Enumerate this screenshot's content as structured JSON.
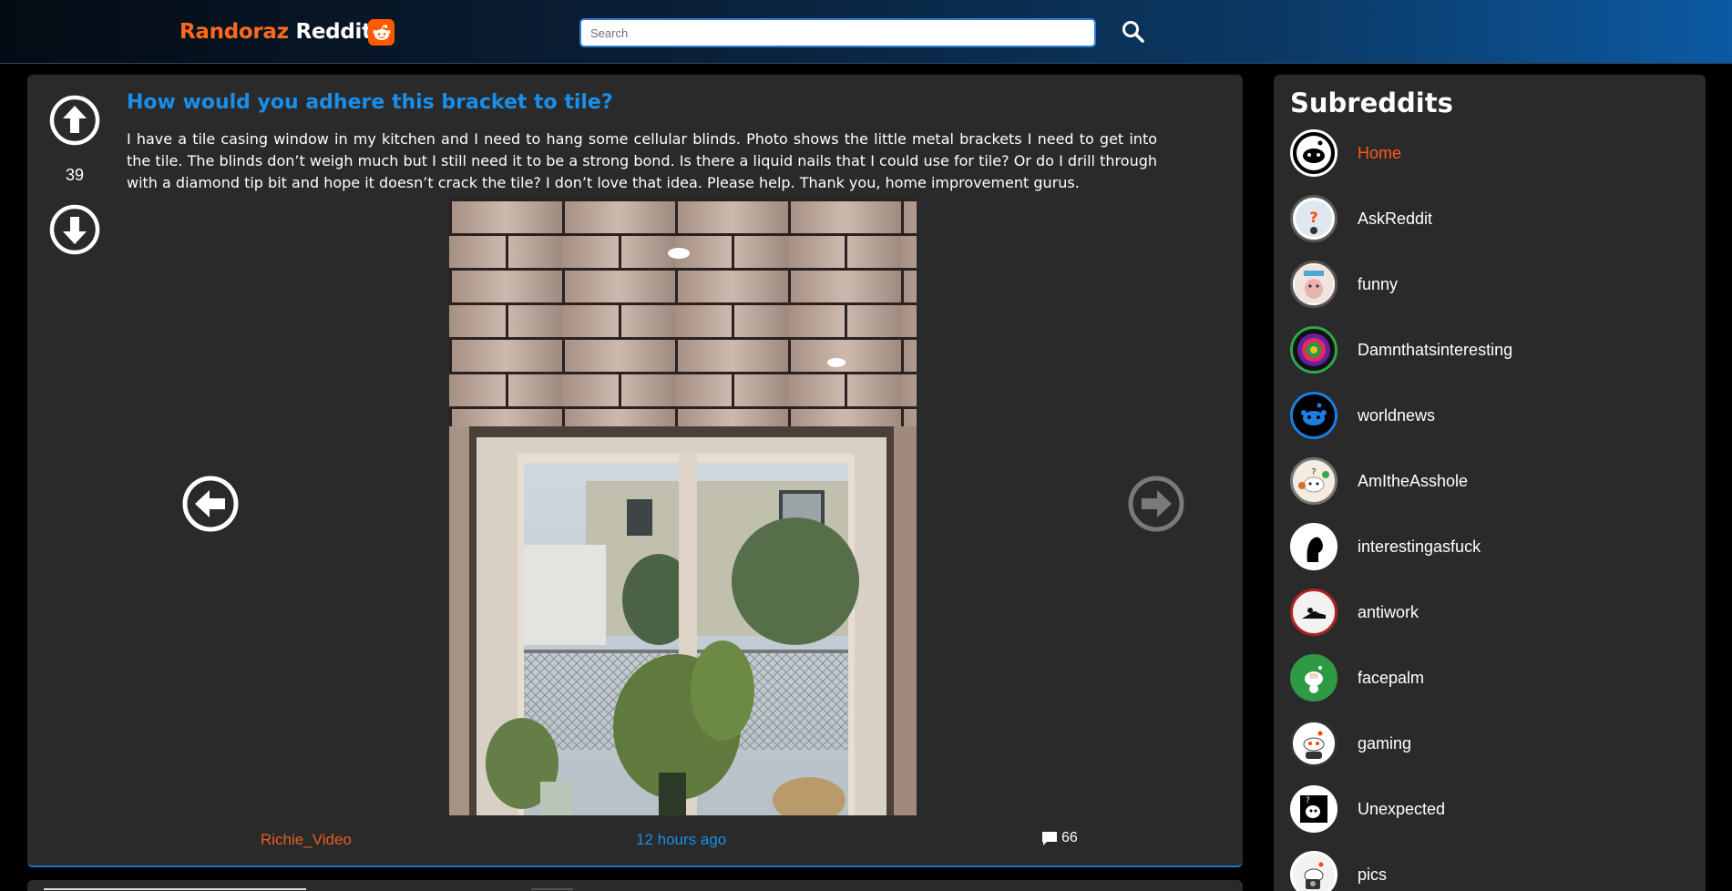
{
  "header": {
    "brand_part1": "Randoraz",
    "brand_part2": "Reddit",
    "search_placeholder": "Search"
  },
  "post": {
    "score": "39",
    "title": "How would you adhere this bracket to tile?",
    "body": "I have a tile casing window in my kitchen and I need to hang some cellular blinds. Photo shows the little metal brackets I need to get into the tile. The blinds don’t weigh much but I still need it to be a strong bond. Is there a liquid nails that I could use for tile? Or do I drill through with a diamond tip bit and hope it doesn’t crack the tile? I don’t love that idea. Please help. Thank you, home improvement gurus.",
    "author": "Richie_Video",
    "time": "12 hours ago",
    "comments": "66"
  },
  "sidebar": {
    "title": "Subreddits",
    "items": [
      {
        "label": "Home",
        "active": true
      },
      {
        "label": "AskReddit"
      },
      {
        "label": "funny"
      },
      {
        "label": "Damnthatsinteresting"
      },
      {
        "label": "worldnews"
      },
      {
        "label": "AmItheAsshole"
      },
      {
        "label": "interestingasfuck"
      },
      {
        "label": "antiwork"
      },
      {
        "label": "facepalm"
      },
      {
        "label": "gaming"
      },
      {
        "label": "Unexpected"
      },
      {
        "label": "pics"
      }
    ]
  },
  "colors": {
    "accent_orange": "#ff5a14",
    "link_blue": "#1a8ee8",
    "card_bg": "#2a2a2a"
  }
}
